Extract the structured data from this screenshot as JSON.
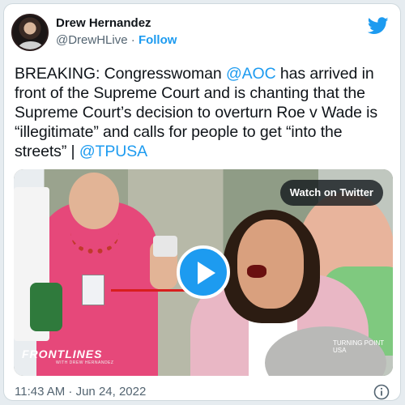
{
  "author": {
    "display_name": "Drew Hernandez",
    "handle": "@DrewHLive",
    "separator": "·",
    "follow_label": "Follow"
  },
  "tweet": {
    "segments": [
      {
        "text": "BREAKING: Congresswoman ",
        "type": "text"
      },
      {
        "text": "@AOC",
        "type": "mention"
      },
      {
        "text": " has arrived in front of the Supreme Court and is chanting that the Supreme Court’s decision to overturn Roe v Wade is “illegitimate” and calls for people to get “into the streets” | ",
        "type": "text"
      },
      {
        "text": "@TPUSA",
        "type": "mention"
      }
    ]
  },
  "media": {
    "watch_label": "Watch on Twitter",
    "watermark_left": "FRONTLINES",
    "watermark_left_sub": "WITH DREW HERNANDEZ",
    "watermark_right": "TURNING POINT USA"
  },
  "footer": {
    "timestamp": "11:43 AM · Jun 24, 2022"
  },
  "icons": {
    "brand": "twitter-bird-icon",
    "play": "play-icon",
    "info": "info-icon"
  },
  "colors": {
    "accent": "#1d9bf0",
    "text": "#0f1419",
    "secondary": "#536471"
  }
}
